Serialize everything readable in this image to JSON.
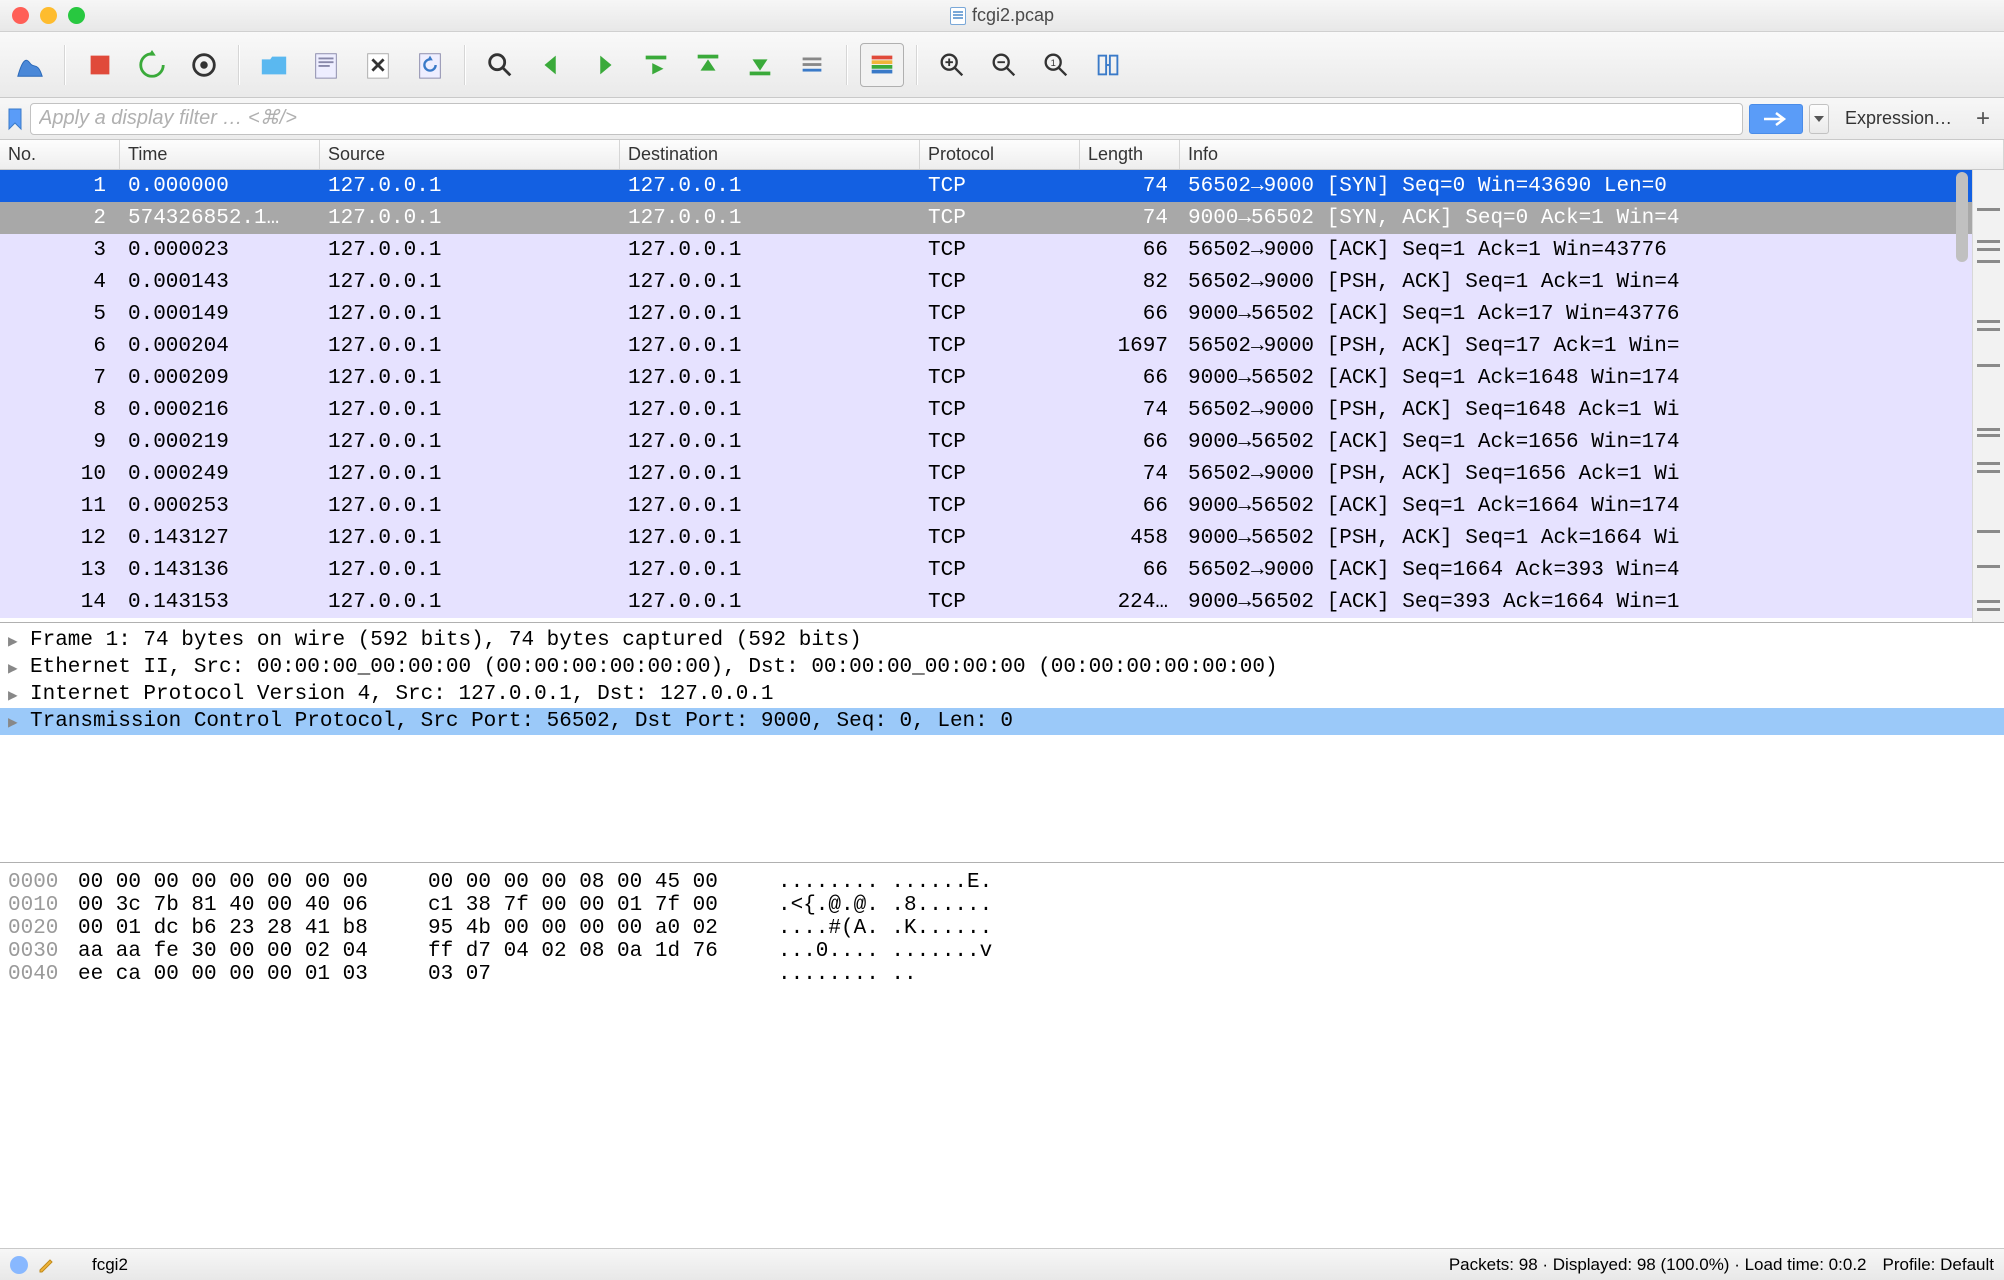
{
  "window": {
    "title": "fcgi2.pcap"
  },
  "filter": {
    "placeholder": "Apply a display filter … <⌘/>",
    "expression_label": "Expression…"
  },
  "columns": {
    "no": "No.",
    "time": "Time",
    "source": "Source",
    "destination": "Destination",
    "protocol": "Protocol",
    "length": "Length",
    "info": "Info"
  },
  "packets": [
    {
      "no": "1",
      "time": "0.000000",
      "src": "127.0.0.1",
      "dst": "127.0.0.1",
      "proto": "TCP",
      "len": "74",
      "info": "56502→9000 [SYN] Seq=0 Win=43690 Len=0",
      "state": "sel"
    },
    {
      "no": "2",
      "time": "574326852.1…",
      "src": "127.0.0.1",
      "dst": "127.0.0.1",
      "proto": "TCP",
      "len": "74",
      "info": "9000→56502 [SYN, ACK] Seq=0 Ack=1 Win=4",
      "state": "rel"
    },
    {
      "no": "3",
      "time": "0.000023",
      "src": "127.0.0.1",
      "dst": "127.0.0.1",
      "proto": "TCP",
      "len": "66",
      "info": "56502→9000 [ACK] Seq=1 Ack=1 Win=43776",
      "state": "tcp"
    },
    {
      "no": "4",
      "time": "0.000143",
      "src": "127.0.0.1",
      "dst": "127.0.0.1",
      "proto": "TCP",
      "len": "82",
      "info": "56502→9000 [PSH, ACK] Seq=1 Ack=1 Win=4",
      "state": "tcp"
    },
    {
      "no": "5",
      "time": "0.000149",
      "src": "127.0.0.1",
      "dst": "127.0.0.1",
      "proto": "TCP",
      "len": "66",
      "info": "9000→56502 [ACK] Seq=1 Ack=17 Win=43776",
      "state": "tcp"
    },
    {
      "no": "6",
      "time": "0.000204",
      "src": "127.0.0.1",
      "dst": "127.0.0.1",
      "proto": "TCP",
      "len": "1697",
      "info": "56502→9000 [PSH, ACK] Seq=17 Ack=1 Win=",
      "state": "tcp"
    },
    {
      "no": "7",
      "time": "0.000209",
      "src": "127.0.0.1",
      "dst": "127.0.0.1",
      "proto": "TCP",
      "len": "66",
      "info": "9000→56502 [ACK] Seq=1 Ack=1648 Win=174",
      "state": "tcp"
    },
    {
      "no": "8",
      "time": "0.000216",
      "src": "127.0.0.1",
      "dst": "127.0.0.1",
      "proto": "TCP",
      "len": "74",
      "info": "56502→9000 [PSH, ACK] Seq=1648 Ack=1 Wi",
      "state": "tcp"
    },
    {
      "no": "9",
      "time": "0.000219",
      "src": "127.0.0.1",
      "dst": "127.0.0.1",
      "proto": "TCP",
      "len": "66",
      "info": "9000→56502 [ACK] Seq=1 Ack=1656 Win=174",
      "state": "tcp"
    },
    {
      "no": "10",
      "time": "0.000249",
      "src": "127.0.0.1",
      "dst": "127.0.0.1",
      "proto": "TCP",
      "len": "74",
      "info": "56502→9000 [PSH, ACK] Seq=1656 Ack=1 Wi",
      "state": "tcp"
    },
    {
      "no": "11",
      "time": "0.000253",
      "src": "127.0.0.1",
      "dst": "127.0.0.1",
      "proto": "TCP",
      "len": "66",
      "info": "9000→56502 [ACK] Seq=1 Ack=1664 Win=174",
      "state": "tcp"
    },
    {
      "no": "12",
      "time": "0.143127",
      "src": "127.0.0.1",
      "dst": "127.0.0.1",
      "proto": "TCP",
      "len": "458",
      "info": "9000→56502 [PSH, ACK] Seq=1 Ack=1664 Wi",
      "state": "tcp"
    },
    {
      "no": "13",
      "time": "0.143136",
      "src": "127.0.0.1",
      "dst": "127.0.0.1",
      "proto": "TCP",
      "len": "66",
      "info": "56502→9000 [ACK] Seq=1664 Ack=393 Win=4",
      "state": "tcp"
    },
    {
      "no": "14",
      "time": "0.143153",
      "src": "127.0.0.1",
      "dst": "127.0.0.1",
      "proto": "TCP",
      "len": "224…",
      "info": "9000→56502 [ACK] Seq=393 Ack=1664 Win=1",
      "state": "tcp"
    }
  ],
  "tree": [
    {
      "text": "Frame 1: 74 bytes on wire (592 bits), 74 bytes captured (592 bits)",
      "hl": false
    },
    {
      "text": "Ethernet II, Src: 00:00:00_00:00:00 (00:00:00:00:00:00), Dst: 00:00:00_00:00:00 (00:00:00:00:00:00)",
      "hl": false
    },
    {
      "text": "Internet Protocol Version 4, Src: 127.0.0.1, Dst: 127.0.0.1",
      "hl": false
    },
    {
      "text": "Transmission Control Protocol, Src Port: 56502, Dst Port: 9000, Seq: 0, Len: 0",
      "hl": true
    }
  ],
  "hex": [
    {
      "off": "0000",
      "b1": "00 00 00 00 00 00 00 00",
      "b2": "00 00 00 00 08 00 45 00",
      "asc": "........ ......E."
    },
    {
      "off": "0010",
      "b1": "00 3c 7b 81 40 00 40 06",
      "b2": "c1 38 7f 00 00 01 7f 00",
      "asc": ".<{.@.@. .8......"
    },
    {
      "off": "0020",
      "b1": "00 01 dc b6 23 28 41 b8",
      "b2": "95 4b 00 00 00 00 a0 02",
      "asc": "....#(A. .K......"
    },
    {
      "off": "0030",
      "b1": "aa aa fe 30 00 00 02 04",
      "b2": "ff d7 04 02 08 0a 1d 76",
      "asc": "...0.... .......v"
    },
    {
      "off": "0040",
      "b1": "ee ca 00 00 00 00 01 03",
      "b2": "03 07",
      "asc": "........ .."
    }
  ],
  "status": {
    "filename": "fcgi2",
    "stats": "Packets: 98 · Displayed: 98 (100.0%) · Load time: 0:0.2",
    "profile_label": "Profile: Default"
  },
  "colors": {
    "selection": "#1360e2",
    "related": "#a8a8a8",
    "tcp_bg": "#e6e2ff",
    "tree_hl": "#9bc9f9"
  }
}
